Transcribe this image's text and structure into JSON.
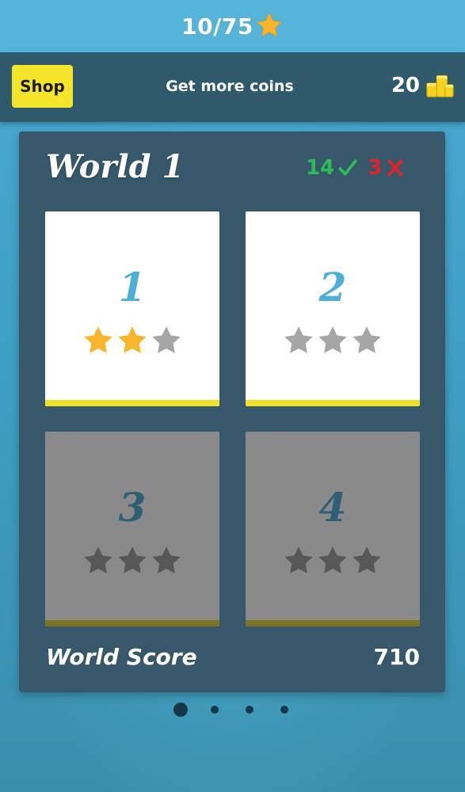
{
  "header": {
    "stars_progress": "10/75",
    "star_icon": "star-icon",
    "star_color": "#f7b52c"
  },
  "coins_bar": {
    "shop_label": "Shop",
    "get_more_coins_label": "Get more coins",
    "coins": "20",
    "coins_icon": "coins-icon",
    "coins_color": "#f5d21d"
  },
  "world": {
    "title": "World 1",
    "correct_count": "14",
    "wrong_count": "3",
    "correct_icon": "check-icon",
    "wrong_icon": "cross-icon",
    "correct_color": "#2cbd57",
    "wrong_color": "#e2222a",
    "score_label": "World Score",
    "score_value": "710",
    "levels": [
      {
        "number": "1",
        "stars": 2,
        "max_stars": 3,
        "locked": false
      },
      {
        "number": "2",
        "stars": 0,
        "max_stars": 3,
        "locked": false
      },
      {
        "number": "3",
        "stars": 0,
        "max_stars": 3,
        "locked": true
      },
      {
        "number": "4",
        "stars": 0,
        "max_stars": 3,
        "locked": true
      }
    ]
  },
  "pagination": {
    "total_pages": 4,
    "current_page": 1
  },
  "colors": {
    "earned_star": "#f7b52c",
    "empty_star_unlocked": "#a5a5a5",
    "empty_star_locked": "#575757",
    "tile_accent_unlocked": "#f0e127",
    "tile_accent_locked": "#7b7325"
  }
}
